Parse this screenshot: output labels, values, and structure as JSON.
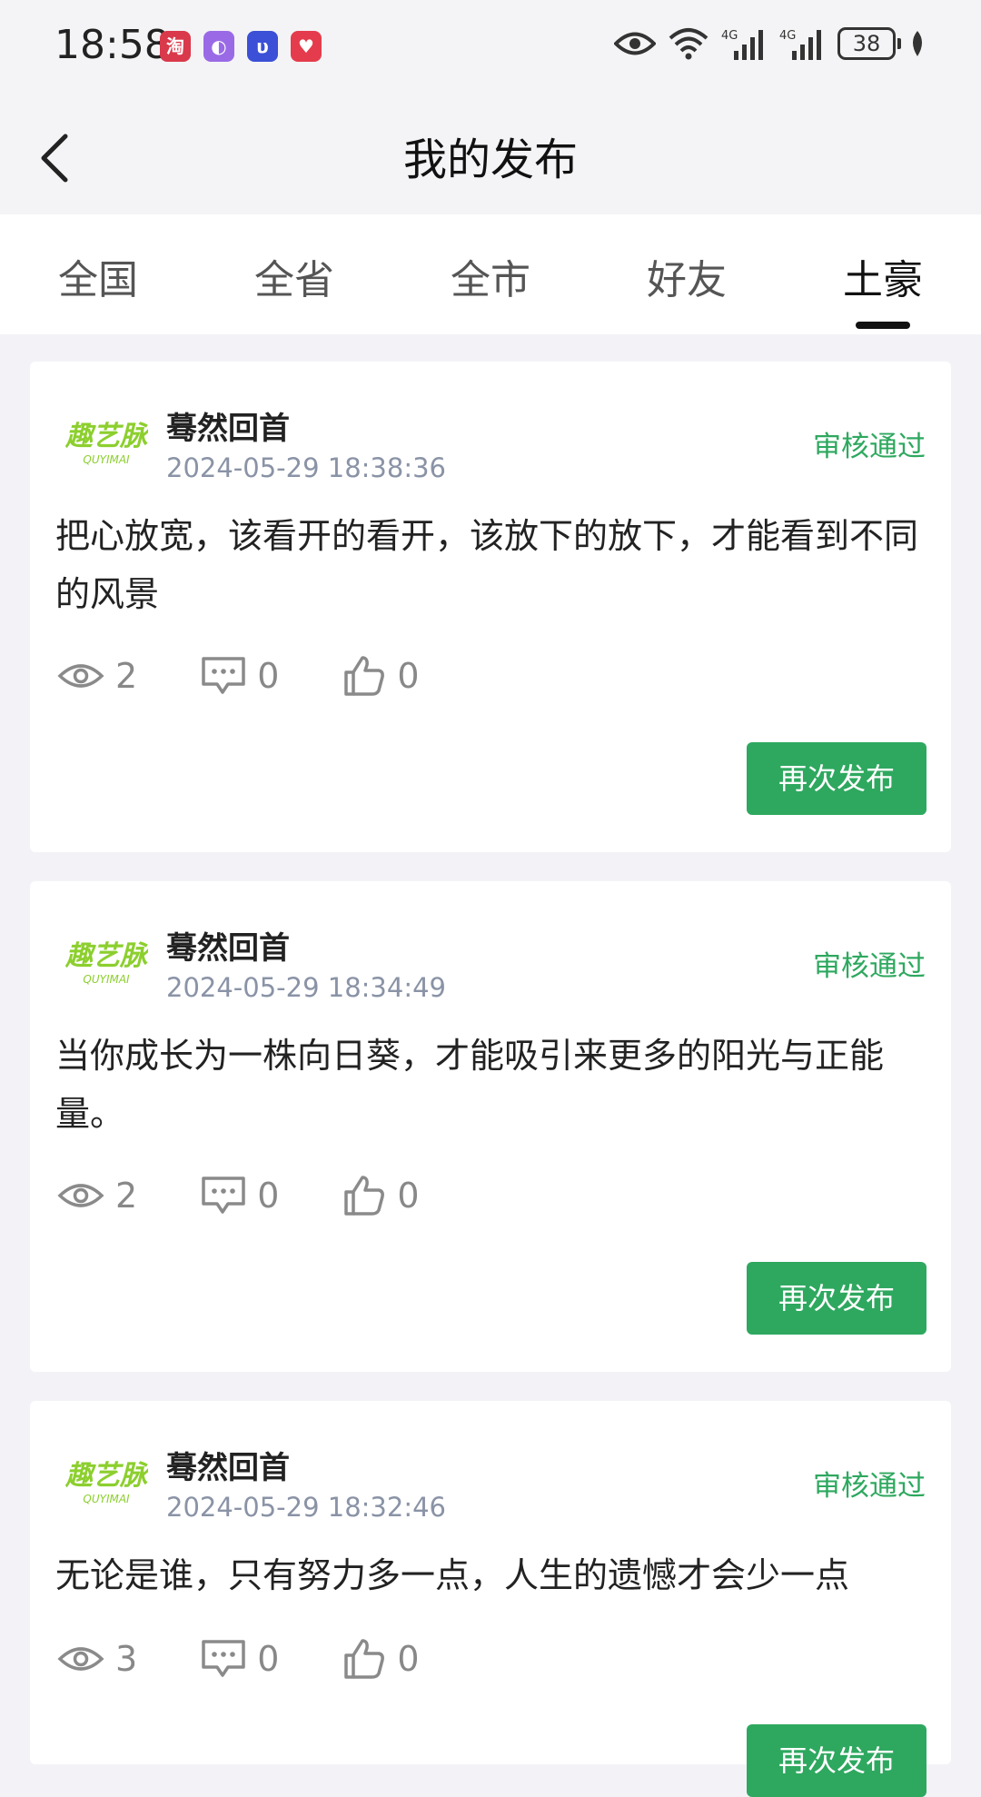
{
  "status_bar": {
    "time": "18:58",
    "notif_icons": [
      {
        "name": "taobao-icon",
        "glyph": "淘",
        "color": "#d9394b"
      },
      {
        "name": "app-purple-icon",
        "glyph": "◐",
        "color": "#9a6ae6"
      },
      {
        "name": "app-blue-icon",
        "glyph": "υ",
        "color": "#3b50d6"
      },
      {
        "name": "app-red-icon",
        "glyph": "♥",
        "color": "#e43c4c"
      }
    ],
    "battery": "38"
  },
  "header": {
    "title": "我的发布"
  },
  "tabs": [
    {
      "label": "全国"
    },
    {
      "label": "全省"
    },
    {
      "label": "全市"
    },
    {
      "label": "好友"
    },
    {
      "label": "土豪"
    }
  ],
  "posts": [
    {
      "logo_text": "趣艺脉",
      "logo_sub": "QUYIMAI",
      "author": "蓦然回首",
      "date": "2024-05-29 18:38:36",
      "status": "审核通过",
      "content": "把心放宽，该看开的看开，该放下的放下，才能看到不同的风景",
      "views": "2",
      "comments": "0",
      "likes": "0",
      "action": "再次发布"
    },
    {
      "logo_text": "趣艺脉",
      "logo_sub": "QUYIMAI",
      "author": "蓦然回首",
      "date": "2024-05-29 18:34:49",
      "status": "审核通过",
      "content": "当你成长为一株向日葵，才能吸引来更多的阳光与正能量。",
      "views": "2",
      "comments": "0",
      "likes": "0",
      "action": "再次发布"
    },
    {
      "logo_text": "趣艺脉",
      "logo_sub": "QUYIMAI",
      "author": "蓦然回首",
      "date": "2024-05-29 18:32:46",
      "status": "审核通过",
      "content": "无论是谁，只有努力多一点，人生的遗憾才会少一点",
      "views": "3",
      "comments": "0",
      "likes": "0",
      "action": "再次发布"
    }
  ],
  "colors": {
    "accent": "#2ea85f",
    "date": "#8a93a6"
  }
}
